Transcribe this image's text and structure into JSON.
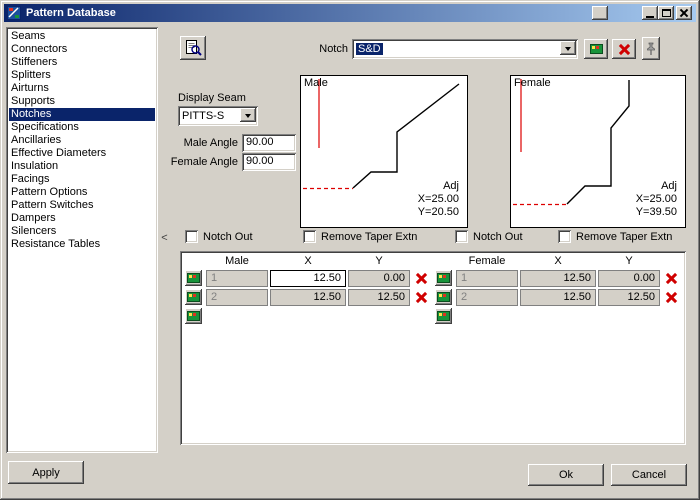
{
  "window": {
    "title": "Pattern Database"
  },
  "sidebar": {
    "items": [
      "Seams",
      "Connectors",
      "Stiffeners",
      "Splitters",
      "Airturns",
      "Supports",
      "Notches",
      "Specifications",
      "Ancillaries",
      "Effective Diameters",
      "Insulation",
      "Facings",
      "Pattern Options",
      "Pattern Switches",
      "Dampers",
      "Silencers",
      "Resistance Tables"
    ],
    "selected_item": "Notches",
    "collapse_glyph": "<"
  },
  "toolbar": {
    "notch_label": "Notch",
    "notch_value": "S&D"
  },
  "seam": {
    "display_seam_label": "Display Seam",
    "display_seam_value": "PITTS-S",
    "male_angle_label": "Male Angle",
    "male_angle_value": "90.00",
    "female_angle_label": "Female Angle",
    "female_angle_value": "90.00"
  },
  "previews": {
    "male": {
      "label": "Male",
      "adj": "Adj",
      "x": "X=25.00",
      "y": "Y=20.50"
    },
    "female": {
      "label": "Female",
      "adj": "Adj",
      "x": "X=25.00",
      "y": "Y=39.50"
    }
  },
  "checkboxes": [
    {
      "label": "Notch Out",
      "checked": false
    },
    {
      "label": "Remove Taper Extn",
      "checked": false
    },
    {
      "label": "Notch Out",
      "checked": false
    },
    {
      "label": "Remove Taper Extn",
      "checked": false
    }
  ],
  "table": {
    "male": {
      "header": "Male",
      "x_header": "X",
      "y_header": "Y",
      "rows": [
        {
          "num": "1",
          "x": "12.50",
          "y": "0.00"
        },
        {
          "num": "2",
          "x": "12.50",
          "y": "12.50"
        }
      ]
    },
    "female": {
      "header": "Female",
      "x_header": "X",
      "y_header": "Y",
      "rows": [
        {
          "num": "1",
          "x": "12.50",
          "y": "0.00"
        },
        {
          "num": "2",
          "x": "12.50",
          "y": "12.50"
        }
      ]
    }
  },
  "footer": {
    "apply_label": "Apply",
    "ok_label": "Ok",
    "cancel_label": "Cancel"
  },
  "colors": {
    "titlebar_left": "#0a246a",
    "titlebar_right": "#a6caf0",
    "selection": "#0a246a",
    "dialog_face": "#d4d0c8",
    "drawing_red": "#dd0000",
    "drawing_black": "#000000",
    "add_button_green": "#18933a",
    "delete_red": "#d00000"
  }
}
